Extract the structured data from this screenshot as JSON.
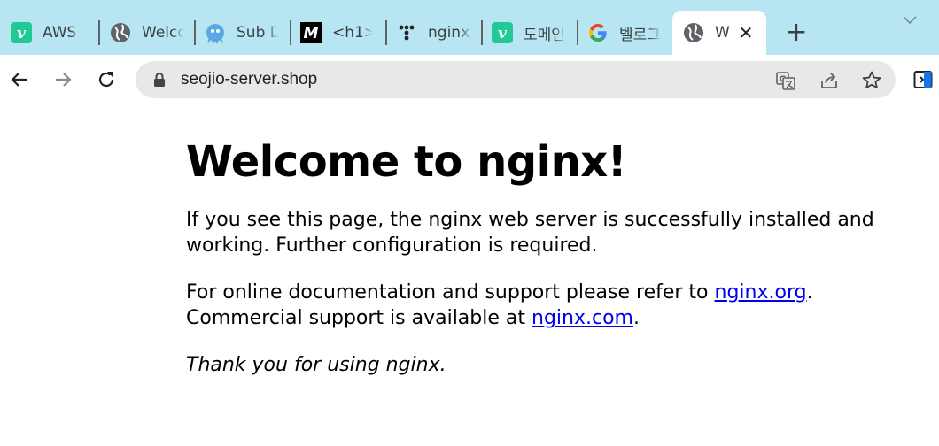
{
  "browser": {
    "tabs": [
      {
        "title": "AWS",
        "icon": "velog-v-icon"
      },
      {
        "title": "Welco",
        "icon": "globe-icon"
      },
      {
        "title": "Sub D",
        "icon": "octocat-icon"
      },
      {
        "title": "<h1>",
        "icon": "medium-m-icon"
      },
      {
        "title": "nginx",
        "icon": "dots-logo-icon"
      },
      {
        "title": "도메인",
        "icon": "velog-v-icon"
      },
      {
        "title": "벨로그",
        "icon": "google-g-icon"
      },
      {
        "title": "W",
        "icon": "globe-icon",
        "active": true
      }
    ],
    "new_tab_label": "+",
    "close_label": "✕",
    "url": "seojio-server.shop"
  },
  "page": {
    "heading": "Welcome to nginx!",
    "p1": "If you see this page, the nginx web server is successfully installed and working. Further configuration is required.",
    "p2_text1": "For online documentation and support please refer to ",
    "p2_link1": "nginx.org",
    "p2_text2": ".",
    "p2_text3": "Commercial support is available at ",
    "p2_link2": "nginx.com",
    "p2_text4": ".",
    "p3": "Thank you for using nginx."
  },
  "colors": {
    "tabstrip_bg": "#b7e5f2",
    "velog_green": "#20c997",
    "link": "#0000ee"
  }
}
